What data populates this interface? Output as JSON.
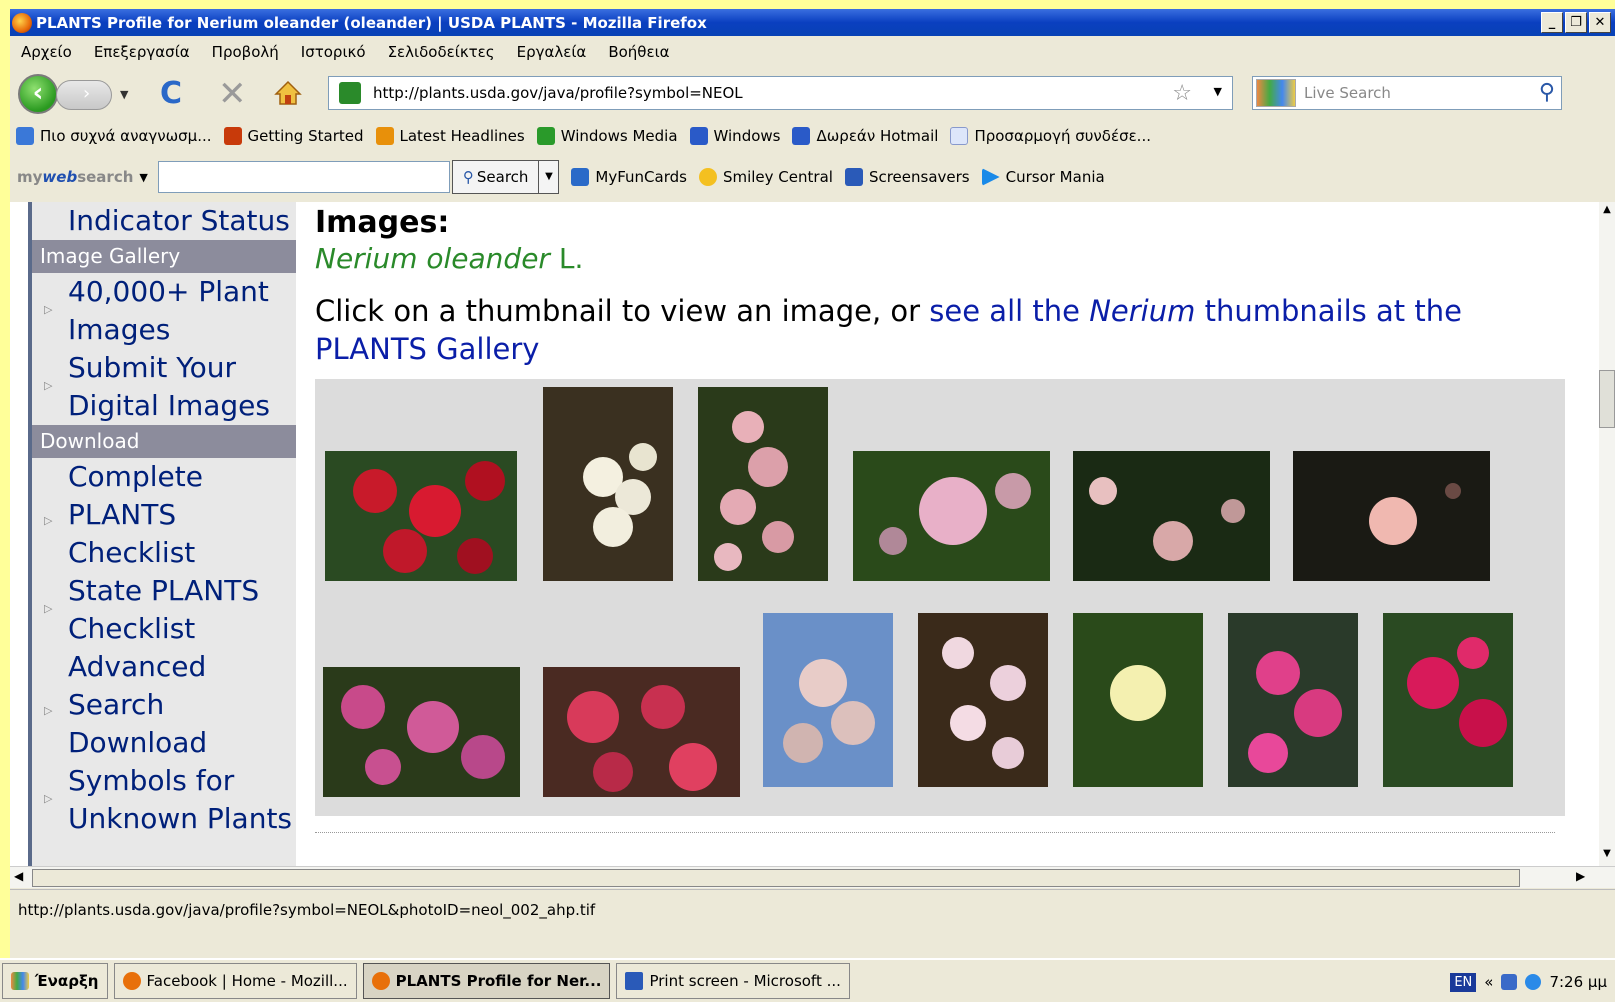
{
  "window": {
    "title": "PLANTS Profile for Nerium oleander (oleander) | USDA PLANTS - Mozilla Firefox"
  },
  "menu": [
    "Αρχείο",
    "Επεξεργασία",
    "Προβολή",
    "Ιστορικό",
    "Σελιδοδείκτες",
    "Εργαλεία",
    "Βοήθεια"
  ],
  "nav": {
    "url": "http://plants.usda.gov/java/profile?symbol=NEOL",
    "search_placeholder": "Live Search"
  },
  "bookmarks": [
    {
      "label": "Πιο συχνά αναγνωσμ...",
      "icon": "most-visited-icon",
      "color": "#3a78d8"
    },
    {
      "label": "Getting Started",
      "icon": "firefox-leaf-icon",
      "color": "#c83a0a"
    },
    {
      "label": "Latest Headlines",
      "icon": "rss-icon",
      "color": "#e8900a"
    },
    {
      "label": "Windows Media",
      "icon": "windows-flag-icon",
      "color": "#2a9a2a"
    },
    {
      "label": "Windows",
      "icon": "msn-icon",
      "color": "#2a5ac8"
    },
    {
      "label": "Δωρεάν Hotmail",
      "icon": "msn-icon",
      "color": "#2a5ac8"
    },
    {
      "label": "Προσαρμογή συνδέσε...",
      "icon": "page-icon",
      "color": "#aabbee"
    }
  ],
  "mywebsearch": {
    "logo_pre": "my",
    "logo_mid": "web",
    "logo_post": "search",
    "search_label": "Search",
    "tools": [
      {
        "label": "MyFunCards",
        "icon": "card-icon",
        "color": "#2a6ac8"
      },
      {
        "label": "Smiley Central",
        "icon": "smiley-icon",
        "color": "#f4c020"
      },
      {
        "label": "Screensavers",
        "icon": "monitor-icon",
        "color": "#2a5ab8"
      },
      {
        "label": "Cursor Mania",
        "icon": "cursor-icon",
        "color": "#1a8ae8"
      }
    ]
  },
  "leftnav": {
    "top_link": "Indicator Status",
    "section1": "Image Gallery",
    "links1": [
      [
        "40,000+ Plant",
        "Images"
      ],
      [
        "Submit Your",
        "Digital Images"
      ]
    ],
    "section2": "Download",
    "links2": [
      [
        "Complete",
        "PLANTS",
        "Checklist"
      ],
      [
        "State PLANTS",
        "Checklist"
      ],
      [
        "Advanced",
        "Search",
        "Download"
      ],
      [
        "Symbols for",
        "Unknown Plants"
      ]
    ]
  },
  "main": {
    "heading": "Images:",
    "genus": "Nerium oleander",
    "author": "L.",
    "intro_text": "Click on a thumbnail to view an image, or ",
    "intro_link_pre": "see all the ",
    "intro_link_genus": "Nerium",
    "intro_link_post": " thumbnails at the",
    "intro_link_line2": "PLANTS Gallery"
  },
  "status": "http://plants.usda.gov/java/profile?symbol=NEOL&photoID=neol_002_ahp.tif",
  "taskbar": {
    "start": "Έναρξη",
    "tasks": [
      {
        "label": "Facebook | Home - Mozill...",
        "active": false
      },
      {
        "label": "PLANTS Profile for Ner...",
        "active": true
      },
      {
        "label": "Print screen - Microsoft ...",
        "active": false
      }
    ],
    "lang": "EN",
    "time": "7:26 μμ"
  }
}
